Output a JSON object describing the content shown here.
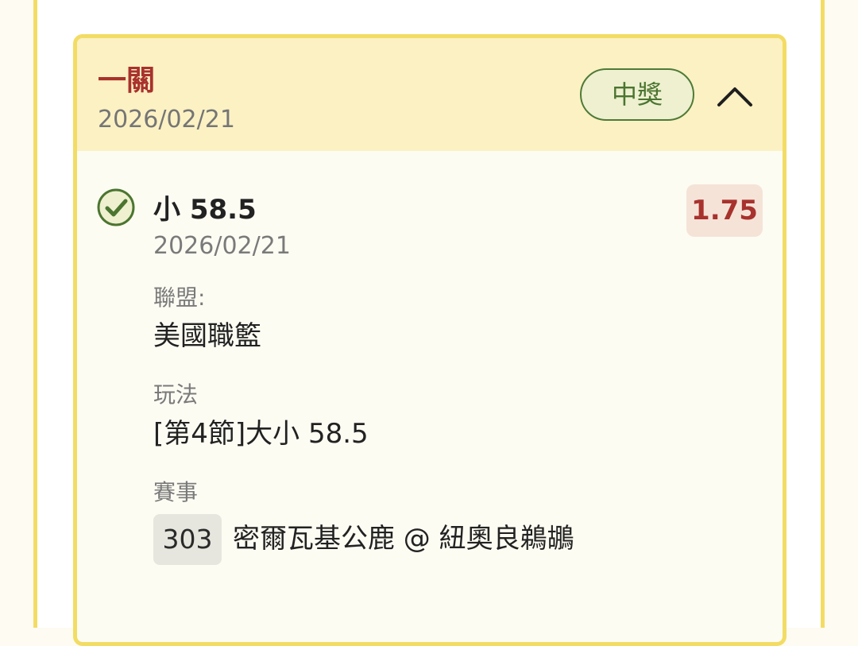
{
  "card": {
    "bet_type": "一關",
    "date": "2026/02/21",
    "status": "中獎",
    "collapse_icon": "chevron-up-icon"
  },
  "selection": {
    "status_icon": "check-circle-icon",
    "name": "小 58.5",
    "date": "2026/02/21",
    "odds": "1.75"
  },
  "details": {
    "league_label": "聯盟:",
    "league_value": "美國職籃",
    "market_label": "玩法",
    "market_value": "[第4節]大小 58.5",
    "event_label": "賽事",
    "event_number": "303",
    "event_name": "密爾瓦基公鹿 @ 紐奧良鵜鶘"
  },
  "colors": {
    "border": "#f3dc64",
    "header_bg": "#fbf1c3",
    "win_green": "#4b7530",
    "odds_red": "#a8322d",
    "odds_bg": "#f5e3d8"
  }
}
